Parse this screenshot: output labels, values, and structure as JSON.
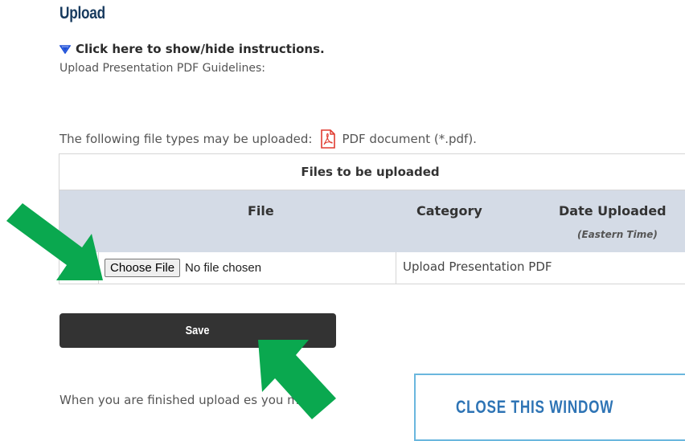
{
  "page": {
    "title": "Upload",
    "toggle_instructions": "Click here to show/hide instructions.",
    "guidelines": "Upload Presentation PDF Guidelines:",
    "file_types_label": "The following file types may be uploaded:",
    "file_type": "PDF document (*.pdf)."
  },
  "table": {
    "caption": "Files to be uploaded",
    "columns": {
      "file": "File",
      "category": "Category",
      "date_uploaded": "Date Uploaded",
      "date_note": "(Eastern Time)"
    },
    "rows": [
      {
        "choose_file_label": "Choose File",
        "file_status": "No file chosen",
        "category": "Upload Presentation PDF"
      }
    ]
  },
  "actions": {
    "save_label": "Save",
    "finished_text": "When you are finished upload  es you may",
    "close_window_label": "CLOSE THIS WINDOW"
  },
  "colors": {
    "title": "#173a5e",
    "header_bg": "#d4dbe6",
    "save_bg": "#333333",
    "close_border": "#6ab7de",
    "close_text": "#2e74b5",
    "arrow": "#0aa84f",
    "toggle_triangle": "#1d4fd8",
    "pdf_icon": "#e03c31"
  },
  "icons": {
    "toggle": "triangle-down-icon",
    "file_type": "pdf-file-icon",
    "annotations": "green-arrow-icon"
  }
}
